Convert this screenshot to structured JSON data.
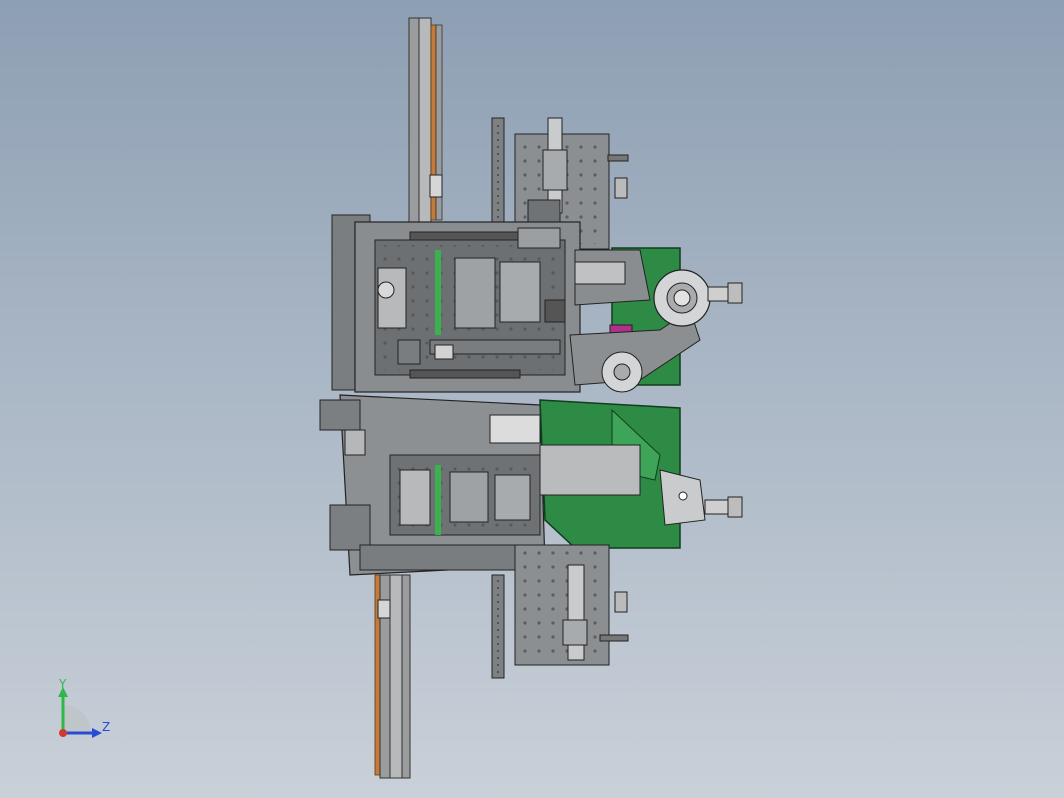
{
  "view": {
    "background_top": "#8d9fb3",
    "background_bottom": "#c9d0d8"
  },
  "triad": {
    "y_label": "Y",
    "z_label": "Z",
    "y_color": "#2fb84a",
    "z_color": "#2a49d6",
    "x_color": "#d13a2f"
  },
  "colors": {
    "steel": "#8e9194",
    "steel_dark": "#5a5d60",
    "green_housing": "#2e8b45",
    "orange_rail": "#c47a3a",
    "magenta_block": "#b0308a"
  }
}
